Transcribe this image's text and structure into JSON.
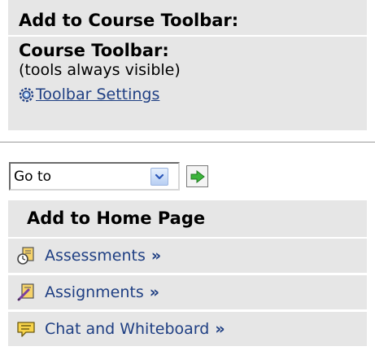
{
  "course_toolbar": {
    "add_heading": "Add to Course Toolbar:",
    "title": "Course Toolbar:",
    "note": "(tools always visible)",
    "settings_link": "Toolbar Settings",
    "settings_icon": "gear-icon"
  },
  "goto": {
    "selected": "Go to",
    "go_icon": "green-arrow-right-icon"
  },
  "home_page": {
    "heading": "Add to Home Page",
    "items": [
      {
        "label": "Assessments",
        "more": "»",
        "icon": "assessment-icon"
      },
      {
        "label": "Assignments",
        "more": "»",
        "icon": "assignment-icon"
      },
      {
        "label": "Chat and Whiteboard",
        "more": "»",
        "icon": "chat-bubble-icon"
      }
    ]
  },
  "colors": {
    "panel_bg": "#e6e6e6",
    "link": "#1f3f83",
    "divider": "#9a9a9a"
  }
}
